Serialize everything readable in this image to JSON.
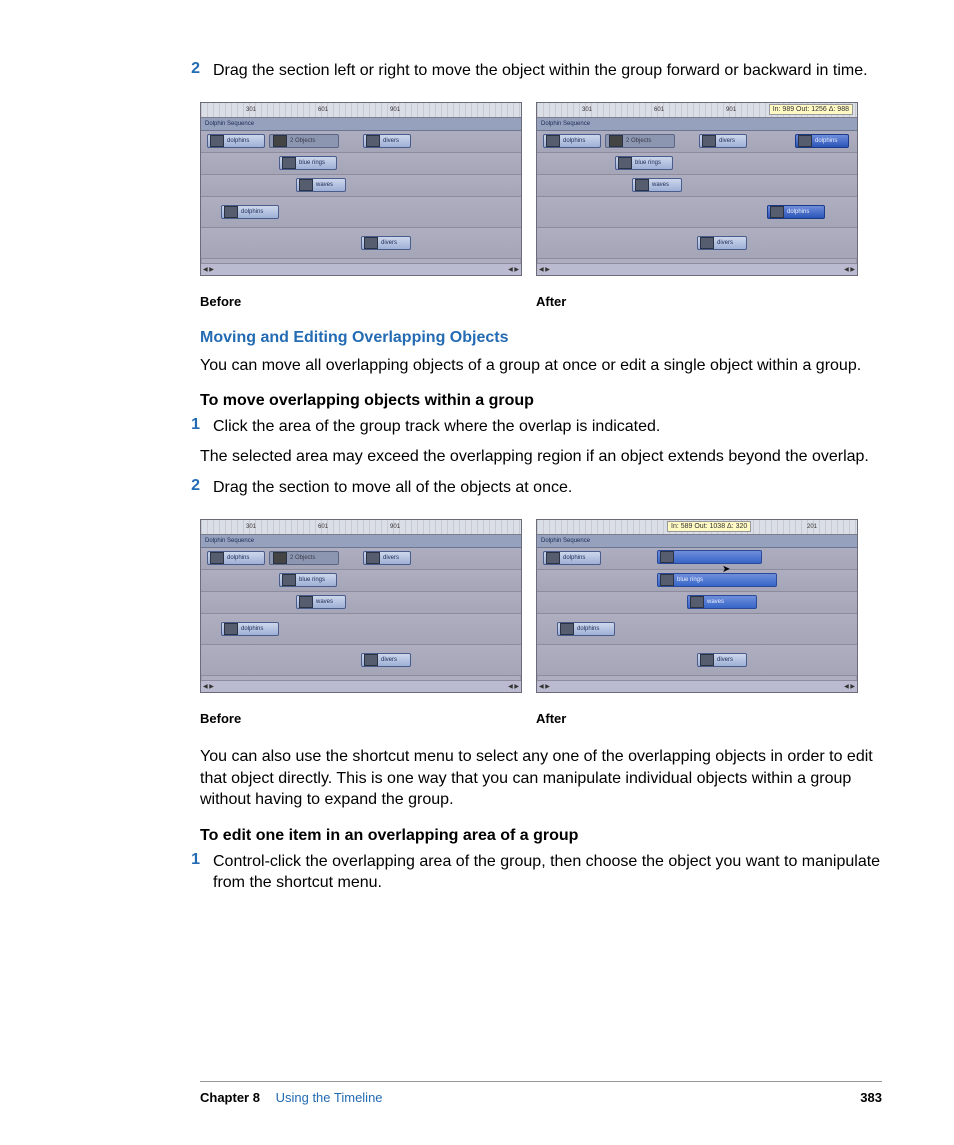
{
  "step2_top": {
    "num": "2",
    "text": "Drag the section left or right to move the object within the group forward or backward in time."
  },
  "captions": {
    "before": "Before",
    "after": "After"
  },
  "heading_blue": "Moving and Editing Overlapping Objects",
  "para_overlap": "You can move all overlapping objects of a group at once or edit a single object within a group.",
  "heading_move": "To move overlapping objects within a group",
  "step1_move": {
    "num": "1",
    "text": "Click the area of the group track where the overlap is indicated."
  },
  "para_selected": "The selected area may exceed the overlapping region if an object extends beyond the overlap.",
  "step2_move": {
    "num": "2",
    "text": "Drag the section to move all of the objects at once."
  },
  "para_shortcut": "You can also use the shortcut menu to select any one of the overlapping objects in order to edit that object directly. This is one way that you can manipulate individual objects within a group without having to expand the group.",
  "heading_edit": "To edit one item in an overlapping area of a group",
  "step1_edit": {
    "num": "1",
    "text": "Control-click the overlapping area of the group, then choose the object you want to manipulate from the shortcut menu."
  },
  "footer": {
    "chapter": "Chapter 8",
    "title": "Using the Timeline",
    "page": "383"
  },
  "timeline": {
    "ruler_marks": [
      "301",
      "601",
      "901"
    ],
    "ruler_marks_b": [
      "201"
    ],
    "group": "Dolphin Sequence",
    "overlap_label": "2 Objects",
    "clips": {
      "dolphins": "dolphins",
      "blue_rings": "blue rings",
      "waves": "waves",
      "divers": "divers"
    },
    "tooltip1": "In: 989 Out: 1256 Δ: 988",
    "tooltip2": "In: 589 Out: 1038 Δ: 320"
  }
}
